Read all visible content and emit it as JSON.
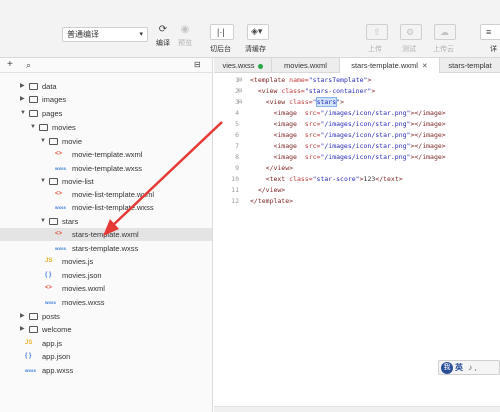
{
  "toolbar": {
    "mode_select": "普通编译",
    "compile_label": "编译",
    "preview_label": "预览",
    "switch_backend_label": "切后台",
    "clear_cache_label": "清缓存",
    "upload_label": "上传",
    "test_label": "测试",
    "upload_cloud_label": "上传云",
    "details_label": "详"
  },
  "sidebar": {
    "items": [
      {
        "label": "data",
        "type": "folder",
        "expanded": false
      },
      {
        "label": "images",
        "type": "folder",
        "expanded": false
      },
      {
        "label": "pages",
        "type": "folder",
        "expanded": true
      },
      {
        "label": "movies",
        "type": "folder",
        "expanded": true
      },
      {
        "label": "movie",
        "type": "folder",
        "expanded": true
      },
      {
        "label": "movie-template.wxml",
        "type": "wxml"
      },
      {
        "label": "movie-template.wxss",
        "type": "wxss"
      },
      {
        "label": "movie-list",
        "type": "folder",
        "expanded": true
      },
      {
        "label": "movie-list-template.wxml",
        "type": "wxml"
      },
      {
        "label": "movie-list-template.wxss",
        "type": "wxss"
      },
      {
        "label": "stars",
        "type": "folder",
        "expanded": true
      },
      {
        "label": "stars-template.wxml",
        "type": "wxml",
        "selected": true
      },
      {
        "label": "stars-template.wxss",
        "type": "wxss"
      },
      {
        "label": "movies.js",
        "type": "js"
      },
      {
        "label": "movies.json",
        "type": "json"
      },
      {
        "label": "movies.wxml",
        "type": "wxml"
      },
      {
        "label": "movies.wxss",
        "type": "wxss"
      },
      {
        "label": "posts",
        "type": "folder",
        "expanded": false
      },
      {
        "label": "welcome",
        "type": "folder",
        "expanded": false
      },
      {
        "label": "app.js",
        "type": "js"
      },
      {
        "label": "app.json",
        "type": "json"
      },
      {
        "label": "app.wxss",
        "type": "wxss"
      }
    ]
  },
  "tabs": [
    {
      "label": "vies.wxss",
      "modified": true
    },
    {
      "label": "movies.wxml"
    },
    {
      "label": "stars-template.wxml",
      "active": true
    },
    {
      "label": "stars-templat"
    }
  ],
  "editor": {
    "line_numbers": [
      "1",
      "2",
      "3",
      "4",
      "5",
      "6",
      "7",
      "8",
      "9",
      "10",
      "11",
      "12"
    ]
  },
  "ime": {
    "logo": "我",
    "label": "英",
    "extra": "♪ ,"
  },
  "icons": {
    "file_wxml": "<>",
    "file_wxss": "wxss",
    "file_js": "JS",
    "file_json": "{ }"
  },
  "colors": {
    "selection": "#cfe3ff",
    "annotation_arrow": "#e53935",
    "modified_dot": "#28a745"
  }
}
